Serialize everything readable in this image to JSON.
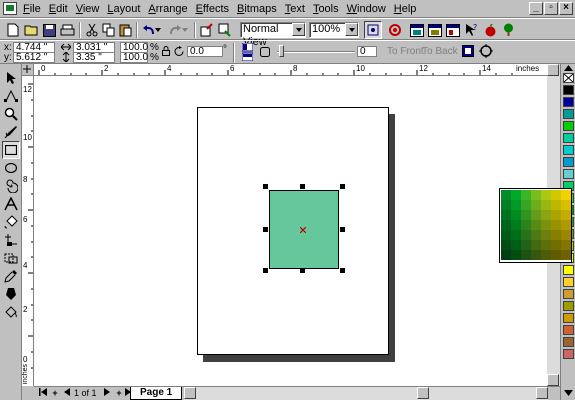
{
  "menu": {
    "items": [
      "File",
      "Edit",
      "View",
      "Layout",
      "Arrange",
      "Effects",
      "Bitmaps",
      "Text",
      "Tools",
      "Window",
      "Help"
    ]
  },
  "window_controls": {
    "minimize": "_",
    "restore": "▫",
    "close": "×"
  },
  "toolbar": {
    "view_mode": "Normal View",
    "zoom": "100%"
  },
  "property_bar": {
    "x": "4.744 \"",
    "y": "5.612 \"",
    "width": "3.031 \"",
    "height": "3.35 \"",
    "scale_x": "100.0",
    "scale_y": "100.0",
    "percent_1": "%",
    "percent_2": "%",
    "rotation": "0.0",
    "degree": "°",
    "corner_roundness": "0",
    "to_front": "To Front",
    "to_back": "To Back"
  },
  "rulers": {
    "units": "inches",
    "h_ticks": [
      "0",
      "2",
      "4",
      "6",
      "8",
      "10",
      "12",
      "14"
    ],
    "v_ticks": [
      "12",
      "10",
      "8",
      "6",
      "4",
      "2",
      "0"
    ],
    "v_units": "inches"
  },
  "status": {
    "page_count": "1 of 1",
    "page_tab": "Page 1"
  },
  "colors": {
    "rectangle_fill": "#66c69c",
    "palette": [
      "#000000",
      "#00009c",
      "#009c9c",
      "#00ce00",
      "#00ce9c",
      "#00cece",
      "#009cce",
      "#66cece",
      "#00ce66",
      "#33cc33",
      "#009c00",
      "#319c31",
      "#669c31",
      "#9cce31",
      "#ceff31",
      "#ffff00",
      "#ffce31",
      "#ce9c31",
      "#9c9c00",
      "#ce9c00",
      "#ce6331",
      "#9c6331",
      "#ce6363"
    ]
  }
}
